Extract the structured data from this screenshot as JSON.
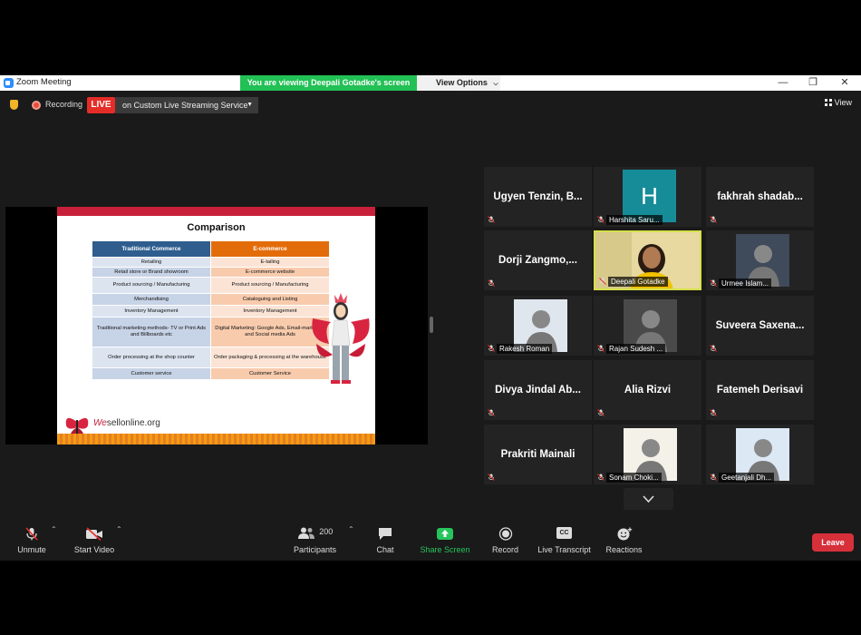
{
  "titlebar": {
    "app_title": "Zoom Meeting",
    "share_banner": "You are viewing Deepali Gotadke's screen",
    "view_options": "View Options",
    "minimize": "—",
    "restore": "❐",
    "close": "✕"
  },
  "top_bar": {
    "recording_label": "Recording",
    "live_badge": "LIVE",
    "stream_label": "on Custom Live Streaming Service",
    "view_label": "View"
  },
  "slide": {
    "title": "Comparison",
    "headers": [
      "Traditional Commerce",
      "E-commerce"
    ],
    "rows": [
      [
        "Retailing",
        "E-tailing"
      ],
      [
        "Retail store or Brand showroom",
        "E-commerce website"
      ],
      [
        "Product sourcing / Manufacturing",
        "Product sourcing / Manufacturing"
      ],
      [
        "Merchandising",
        "Cataloguing and Listing"
      ],
      [
        "Inventory Management",
        "Inventory Management"
      ],
      [
        "Traditional marketing methods- TV or Print Ads and Billboards etc",
        "Digital Marketing: Google Ads, Email-marketing and Social media Ads"
      ],
      [
        "Order processing at the shop counter",
        "Order packaging & processing at the warehouse"
      ],
      [
        "Customer service",
        "Customer Service"
      ]
    ],
    "url_prefix": "We",
    "url_rest": "sellonline.org"
  },
  "gallery": {
    "tiles": [
      {
        "name": "Ugyen  Tenzin,  B...",
        "type": "name"
      },
      {
        "name": "Harshita Saru...",
        "type": "avatar",
        "letter": "H"
      },
      {
        "name": "fakhrah  shadab...",
        "type": "name"
      },
      {
        "name": "Dorji  Zangmo,...",
        "type": "name"
      },
      {
        "name": "Deepali Gotadke",
        "type": "video"
      },
      {
        "name": "Urmee Islam...",
        "type": "photo"
      },
      {
        "name": "Rakesh Roman",
        "type": "photo"
      },
      {
        "name": "Rajan Sudesh ...",
        "type": "photo"
      },
      {
        "name": "Suveera  Saxena...",
        "type": "name"
      },
      {
        "name": "Divya  Jindal  Ab...",
        "type": "name"
      },
      {
        "name": "Alia Rizvi",
        "type": "name"
      },
      {
        "name": "Fatemeh Derisavi",
        "type": "name"
      },
      {
        "name": "Prakriti Mainali",
        "type": "name"
      },
      {
        "name": "Sonam Choki...",
        "type": "photo"
      },
      {
        "name": "Geetanjali Dh...",
        "type": "photo"
      }
    ]
  },
  "toolbar": {
    "unmute": "Unmute",
    "start_video": "Start Video",
    "participants_count": "200",
    "participants": "Participants",
    "chat": "Chat",
    "share_screen": "Share Screen",
    "record": "Record",
    "live_transcript": "Live Transcript",
    "cc": "CC",
    "reactions": "Reactions",
    "leave": "Leave"
  },
  "colors": {
    "share_green": "#22c055",
    "live_red": "#e52d27",
    "leave_red": "#d6303a",
    "active_speaker": "#d6e04a"
  }
}
